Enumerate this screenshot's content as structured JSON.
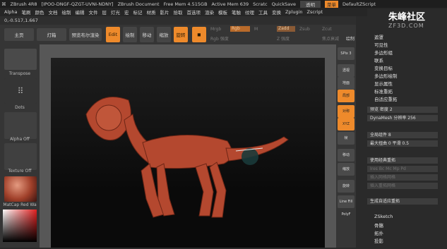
{
  "titlebar": {
    "app": "ZBrush 4R8",
    "doc_id": "[IPOO-DNGF-QZGT-UVNI-NDNY]",
    "doc": "ZBrush Document",
    "free_mem": "Free Mem 4.515GB",
    "active_mem": "Active Mem 639",
    "scratch": "Scratc",
    "quicksave": "QuickSave",
    "transparency": "透明",
    "menus_btn": "菜单",
    "script": "DefaultZScript"
  },
  "menubar": [
    "Alpha",
    "笔刷",
    "颜色",
    "文档",
    "绘制",
    "编辑",
    "文件",
    "层",
    "灯光",
    "宏",
    "标记",
    "材质",
    "影片",
    "拾取",
    "首选项",
    "渲染",
    "模板",
    "笔触",
    "纹理",
    "工具",
    "变换",
    "Zplugin",
    "Zscript"
  ],
  "coord": "0,-0.517,1.667",
  "toolbar": {
    "home": "主页",
    "lightbox": "灯箱",
    "preview": "预览布尔渲染",
    "edit": "Edit",
    "draw": "绘制",
    "move": "移动",
    "scale": "缩放",
    "rotate": "旋转",
    "mrgb": "Mrgb",
    "rgb": "Rgb",
    "m": "M",
    "zadd": "Zadd",
    "zsub": "Zsub",
    "zcut": "Zcut",
    "rgb_strength": "Rgb 强度",
    "z_strength": "Z 强度",
    "focal": "焦点衰减",
    "draw_size": "绘制"
  },
  "leftshelf": {
    "transpose": "Transpose",
    "dots": "Dots",
    "alpha_off": "Alpha Off",
    "texture_off": "Texture Off",
    "matcap": "MatCap Red Wa"
  },
  "rightshelf": [
    "SPix 3",
    "透视",
    "地面",
    "局部",
    "对称",
    "XYZ",
    "帧",
    "移动",
    "缩放",
    "旋转",
    "Line Fill PolyF"
  ],
  "watermark": {
    "cn": "朱峰社区",
    "url": "ZF3D.COM"
  },
  "panel": {
    "items": [
      "遮罩",
      "可见性",
      "多边形组",
      "联系",
      "变换目标",
      "多边形绘制",
      "显示属性",
      "标准重拓",
      "自适应重拓"
    ],
    "preview": "预览",
    "density_label": "密度",
    "density": "2",
    "dynamesh": "DynaMesh 分辨率",
    "dynamesh_val": "256",
    "poly_label": "全局组件",
    "poly_val": "8",
    "max_label": "最大扭曲",
    "max_val": "0",
    "smooth_label": "平滑",
    "smooth_val": "0.5",
    "use_label": "使用经典重拓",
    "disabled_row": [
      "Ires",
      "Bc",
      "Mc",
      "Mp",
      "Pd"
    ],
    "insert1": "插入网格网格",
    "insert2": "插入重拓网格",
    "generate": "生成自适应重拓",
    "zsketch": "ZSketch",
    "rig": "骨骼",
    "topo": "拓扑",
    "proj": "投影"
  }
}
